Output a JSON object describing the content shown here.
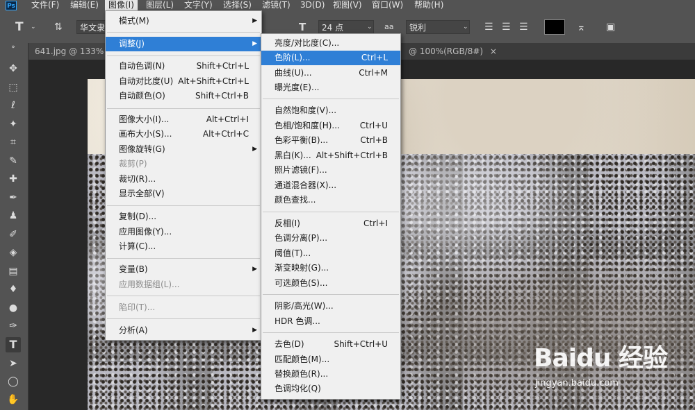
{
  "menubar": {
    "logo": "Ps",
    "items": [
      "文件(F)",
      "编辑(E)",
      "图像(I)",
      "图层(L)",
      "文字(Y)",
      "选择(S)",
      "滤镜(T)",
      "3D(D)",
      "视图(V)",
      "窗口(W)",
      "帮助(H)"
    ]
  },
  "options": {
    "font_family": "华文隶",
    "font_size": "24 点",
    "anti_alias_icon": "aa",
    "anti_alias": "锐利",
    "text_color": "#000000"
  },
  "tabs": {
    "left": "641.jpg @ 133% (",
    "right": "@ 100%(RGB/8#)",
    "close": "×"
  },
  "image_menu": [
    {
      "label": "模式(M)",
      "shortcut": "",
      "submenu": true
    },
    {
      "label": "调整(J)",
      "shortcut": "",
      "submenu": true,
      "highlight": true
    },
    {
      "label": "自动色调(N)",
      "shortcut": "Shift+Ctrl+L"
    },
    {
      "label": "自动对比度(U)",
      "shortcut": "Alt+Shift+Ctrl+L"
    },
    {
      "label": "自动颜色(O)",
      "shortcut": "Shift+Ctrl+B"
    },
    {
      "label": "图像大小(I)...",
      "shortcut": "Alt+Ctrl+I"
    },
    {
      "label": "画布大小(S)...",
      "shortcut": "Alt+Ctrl+C"
    },
    {
      "label": "图像旋转(G)",
      "shortcut": "",
      "submenu": true
    },
    {
      "label": "裁剪(P)",
      "shortcut": "",
      "disabled": true
    },
    {
      "label": "裁切(R)...",
      "shortcut": ""
    },
    {
      "label": "显示全部(V)",
      "shortcut": ""
    },
    {
      "label": "复制(D)...",
      "shortcut": ""
    },
    {
      "label": "应用图像(Y)...",
      "shortcut": ""
    },
    {
      "label": "计算(C)...",
      "shortcut": ""
    },
    {
      "label": "变量(B)",
      "shortcut": "",
      "submenu": true
    },
    {
      "label": "应用数据组(L)...",
      "shortcut": "",
      "disabled": true
    },
    {
      "label": "陷印(T)...",
      "shortcut": "",
      "disabled": true
    },
    {
      "label": "分析(A)",
      "shortcut": "",
      "submenu": true
    }
  ],
  "adjust_menu": [
    {
      "label": "亮度/对比度(C)...",
      "shortcut": ""
    },
    {
      "label": "色阶(L)...",
      "shortcut": "Ctrl+L",
      "highlight": true
    },
    {
      "label": "曲线(U)...",
      "shortcut": "Ctrl+M"
    },
    {
      "label": "曝光度(E)...",
      "shortcut": ""
    },
    {
      "label": "自然饱和度(V)...",
      "shortcut": ""
    },
    {
      "label": "色相/饱和度(H)...",
      "shortcut": "Ctrl+U"
    },
    {
      "label": "色彩平衡(B)...",
      "shortcut": "Ctrl+B"
    },
    {
      "label": "黑白(K)...",
      "shortcut": "Alt+Shift+Ctrl+B"
    },
    {
      "label": "照片滤镜(F)...",
      "shortcut": ""
    },
    {
      "label": "通道混合器(X)...",
      "shortcut": ""
    },
    {
      "label": "颜色查找...",
      "shortcut": ""
    },
    {
      "label": "反相(I)",
      "shortcut": "Ctrl+I"
    },
    {
      "label": "色调分离(P)...",
      "shortcut": ""
    },
    {
      "label": "阈值(T)...",
      "shortcut": ""
    },
    {
      "label": "渐变映射(G)...",
      "shortcut": ""
    },
    {
      "label": "可选颜色(S)...",
      "shortcut": ""
    },
    {
      "label": "阴影/高光(W)...",
      "shortcut": ""
    },
    {
      "label": "HDR 色调...",
      "shortcut": ""
    },
    {
      "label": "去色(D)",
      "shortcut": "Shift+Ctrl+U"
    },
    {
      "label": "匹配颜色(M)...",
      "shortcut": ""
    },
    {
      "label": "替换颜色(R)...",
      "shortcut": ""
    },
    {
      "label": "色调均化(Q)",
      "shortcut": ""
    }
  ],
  "watermark": {
    "logo": "Baiдu 经验",
    "url": "jingyan.baidu.com"
  },
  "colors": {
    "highlight": "#2f7fd6",
    "menu_bg": "#f0f0f0",
    "ui_bg": "#535353"
  }
}
